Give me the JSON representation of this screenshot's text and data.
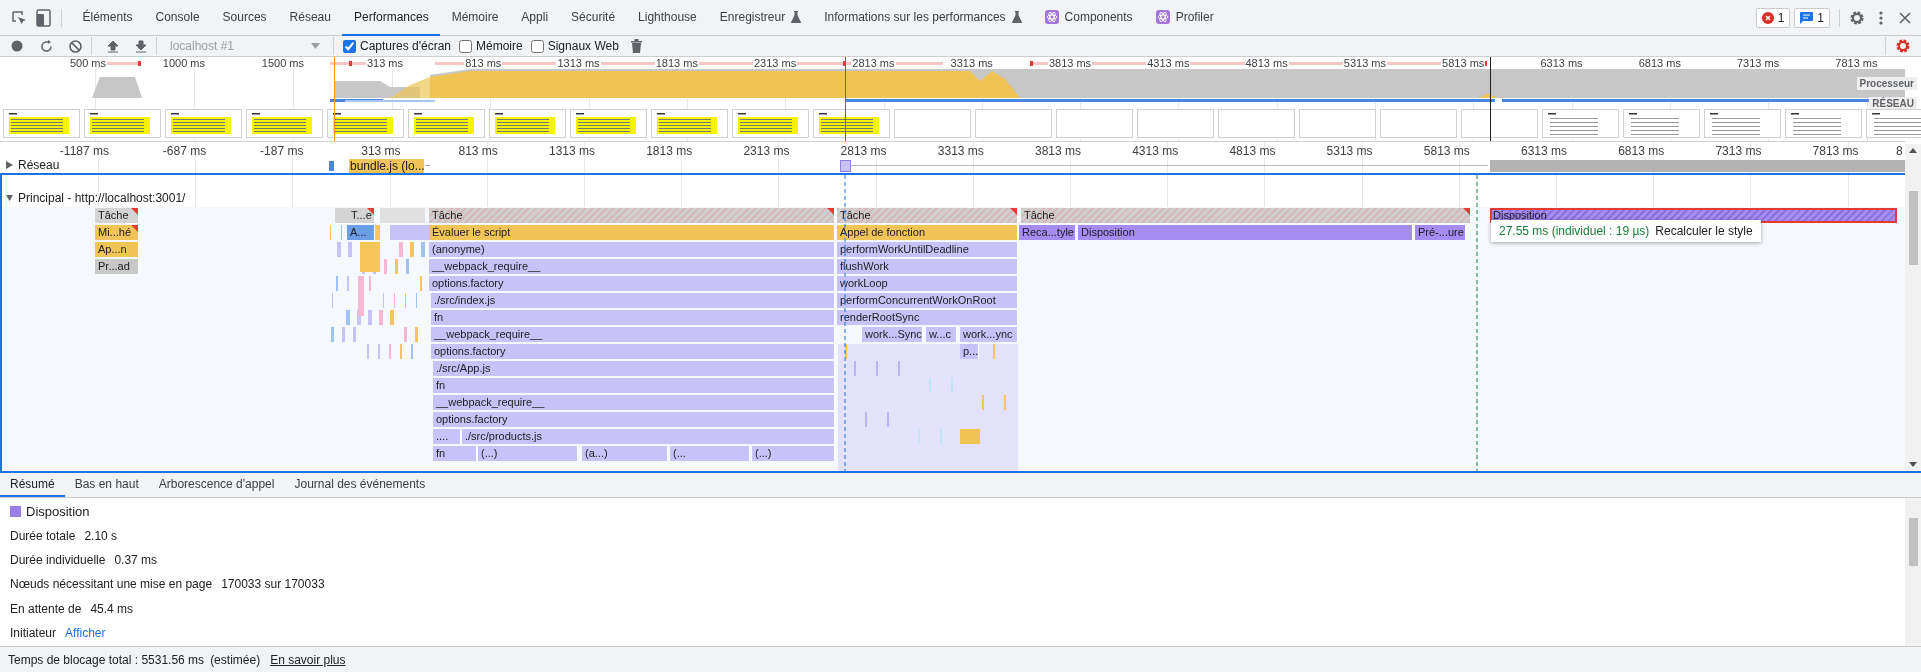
{
  "devtools_tabs": [
    {
      "label": "Éléments",
      "selected": false,
      "kind": "plain"
    },
    {
      "label": "Console",
      "selected": false,
      "kind": "plain"
    },
    {
      "label": "Sources",
      "selected": false,
      "kind": "plain"
    },
    {
      "label": "Réseau",
      "selected": false,
      "kind": "plain"
    },
    {
      "label": "Performances",
      "selected": true,
      "kind": "plain"
    },
    {
      "label": "Mémoire",
      "selected": false,
      "kind": "plain"
    },
    {
      "label": "Appli",
      "selected": false,
      "kind": "plain"
    },
    {
      "label": "Sécurité",
      "selected": false,
      "kind": "plain"
    },
    {
      "label": "Lighthouse",
      "selected": false,
      "kind": "plain"
    },
    {
      "label": "Enregistreur",
      "selected": false,
      "kind": "experimental"
    },
    {
      "label": "Informations sur les performances",
      "selected": false,
      "kind": "experimental"
    },
    {
      "label": "Components",
      "selected": false,
      "kind": "extension"
    },
    {
      "label": "Profiler",
      "selected": false,
      "kind": "extension"
    }
  ],
  "badges": [
    {
      "kind": "error",
      "count": "1"
    },
    {
      "kind": "message",
      "count": "1"
    }
  ],
  "toolbar": {
    "target": "localhost #1",
    "target_disabled": true,
    "options": [
      {
        "label": "Captures d'écran",
        "checked": true
      },
      {
        "label": "Mémoire",
        "checked": false
      },
      {
        "label": "Signaux Web",
        "checked": false
      }
    ]
  },
  "overview": {
    "ticks": [
      "500 ms",
      "1000 ms",
      "1500 ms",
      "313 ms",
      "813 ms",
      "1313 ms",
      "1813 ms",
      "2313 ms",
      "2813 ms",
      "3313 ms",
      "3813 ms",
      "4313 ms",
      "4813 ms",
      "5313 ms",
      "5813 ms",
      "6313 ms",
      "6813 ms",
      "7313 ms",
      "7813 ms"
    ],
    "cpu_label": "Processeur",
    "network_label": "RÉSEAU"
  },
  "ruler": {
    "ticks": [
      "-1187 ms",
      "-687 ms",
      "-187 ms",
      "313 ms",
      "813 ms",
      "1313 ms",
      "1813 ms",
      "2313 ms",
      "2813 ms",
      "3313 ms",
      "3813 ms",
      "4313 ms",
      "4813 ms",
      "5313 ms",
      "5813 ms",
      "6313 ms",
      "6813 ms",
      "7313 ms",
      "7813 ms",
      "8"
    ]
  },
  "network_track": {
    "title": "Réseau",
    "expanded": false,
    "requests": [
      {
        "label": "bundle.js (lo..."
      }
    ]
  },
  "main_track": {
    "title": "Principal - http://localhost:3001/",
    "expanded": true,
    "events": [
      {
        "label": "Tâche",
        "kind": "task",
        "warning": true,
        "selected": false
      },
      {
        "label": "T...e",
        "kind": "task",
        "warning": true,
        "selected": false
      },
      {
        "label": "Tâche",
        "kind": "long-task",
        "warning": true,
        "selected": false
      },
      {
        "label": "Tâche",
        "kind": "long-task",
        "warning": true,
        "selected": false
      },
      {
        "label": "Tâche",
        "kind": "long-task",
        "warning": true,
        "selected": false
      },
      {
        "label": "Disposition",
        "kind": "long-rendering",
        "warning": false,
        "selected": true
      },
      {
        "label": "Mi...hé",
        "kind": "script",
        "warning": true,
        "selected": false
      },
      {
        "label": "A...",
        "kind": "parse",
        "warning": false,
        "selected": false
      },
      {
        "label": "Évaluer le script",
        "kind": "script",
        "warning": false,
        "selected": false
      },
      {
        "label": "Appel de fonction",
        "kind": "script",
        "warning": false,
        "selected": false
      },
      {
        "label": "Reca...tyle",
        "kind": "rendering",
        "warning": false,
        "selected": false
      },
      {
        "label": "Disposition",
        "kind": "rendering",
        "warning": false,
        "selected": false
      },
      {
        "label": "Pré-...ure",
        "kind": "rendering",
        "warning": false,
        "selected": false
      },
      {
        "label": "Ap...n",
        "kind": "script",
        "warning": false,
        "selected": false
      },
      {
        "label": "(anonyme)",
        "kind": "function",
        "warning": false,
        "selected": false
      },
      {
        "label": "performWorkUntilDeadline",
        "kind": "function",
        "warning": false,
        "selected": false
      },
      {
        "label": "Pr...ad",
        "kind": "other",
        "warning": false,
        "selected": false
      },
      {
        "label": "__webpack_require__",
        "kind": "function",
        "warning": false,
        "selected": false
      },
      {
        "label": "flushWork",
        "kind": "function",
        "warning": false,
        "selected": false
      },
      {
        "label": "options.factory",
        "kind": "function",
        "warning": false,
        "selected": false
      },
      {
        "label": "workLoop",
        "kind": "function",
        "warning": false,
        "selected": false
      },
      {
        "label": "./src/index.js",
        "kind": "function",
        "warning": false,
        "selected": false
      },
      {
        "label": "performConcurrentWorkOnRoot",
        "kind": "function",
        "warning": false,
        "selected": false
      },
      {
        "label": "fn",
        "kind": "function",
        "warning": false,
        "selected": false
      },
      {
        "label": "renderRootSync",
        "kind": "function",
        "warning": false,
        "selected": false
      },
      {
        "label": "__webpack_require__",
        "kind": "function",
        "warning": false,
        "selected": false
      },
      {
        "label": "work...Sync",
        "kind": "function",
        "warning": false,
        "selected": false
      },
      {
        "label": "w...c",
        "kind": "function",
        "warning": false,
        "selected": false
      },
      {
        "label": "work...ync",
        "kind": "function",
        "warning": false,
        "selected": false
      },
      {
        "label": "options.factory",
        "kind": "function",
        "warning": false,
        "selected": false
      },
      {
        "label": "p...",
        "kind": "function",
        "warning": false,
        "selected": false
      },
      {
        "label": "./src/App.js",
        "kind": "function",
        "warning": false,
        "selected": false
      },
      {
        "label": "fn",
        "kind": "function",
        "warning": false,
        "selected": false
      },
      {
        "label": "__webpack_require__",
        "kind": "function",
        "warning": false,
        "selected": false
      },
      {
        "label": "options.factory",
        "kind": "function",
        "warning": false,
        "selected": false
      },
      {
        "label": "....",
        "kind": "function",
        "warning": false,
        "selected": false
      },
      {
        "label": "./src/products.js",
        "kind": "function",
        "warning": false,
        "selected": false
      },
      {
        "label": "fn",
        "kind": "function",
        "warning": false,
        "selected": false
      },
      {
        "label": "(...)",
        "kind": "function",
        "warning": false,
        "selected": false
      },
      {
        "label": "(a...)",
        "kind": "function",
        "warning": false,
        "selected": false
      },
      {
        "label": "(...",
        "kind": "function",
        "warning": false,
        "selected": false
      },
      {
        "label": "(...)",
        "kind": "function",
        "warning": false,
        "selected": false
      }
    ]
  },
  "tooltip": {
    "duration": "27.55 ms (individuel : 19 µs)",
    "name": "Recalculer le style"
  },
  "details_tabs": [
    {
      "label": "Résumé",
      "selected": true
    },
    {
      "label": "Bas en haut",
      "selected": false
    },
    {
      "label": "Arborescence d'appel",
      "selected": false
    },
    {
      "label": "Journal des événements",
      "selected": false
    }
  ],
  "summary": {
    "title": "Disposition",
    "rows": [
      {
        "label": "Durée totale",
        "value": "2.10 s",
        "kind": "text"
      },
      {
        "label": "Durée individuelle",
        "value": "0.37 ms",
        "kind": "text"
      },
      {
        "label": "Nœuds nécessitant une mise en page",
        "value": "170033 sur 170033",
        "kind": "text"
      },
      {
        "label": "En attente de",
        "value": "45.4 ms",
        "kind": "text"
      },
      {
        "label": "Initiateur",
        "value": "Afficher",
        "kind": "link"
      }
    ]
  },
  "status_bar": {
    "label": "Temps de blocage total : 5531.56 ms",
    "note": "(estimée)",
    "link": "En savoir plus"
  }
}
